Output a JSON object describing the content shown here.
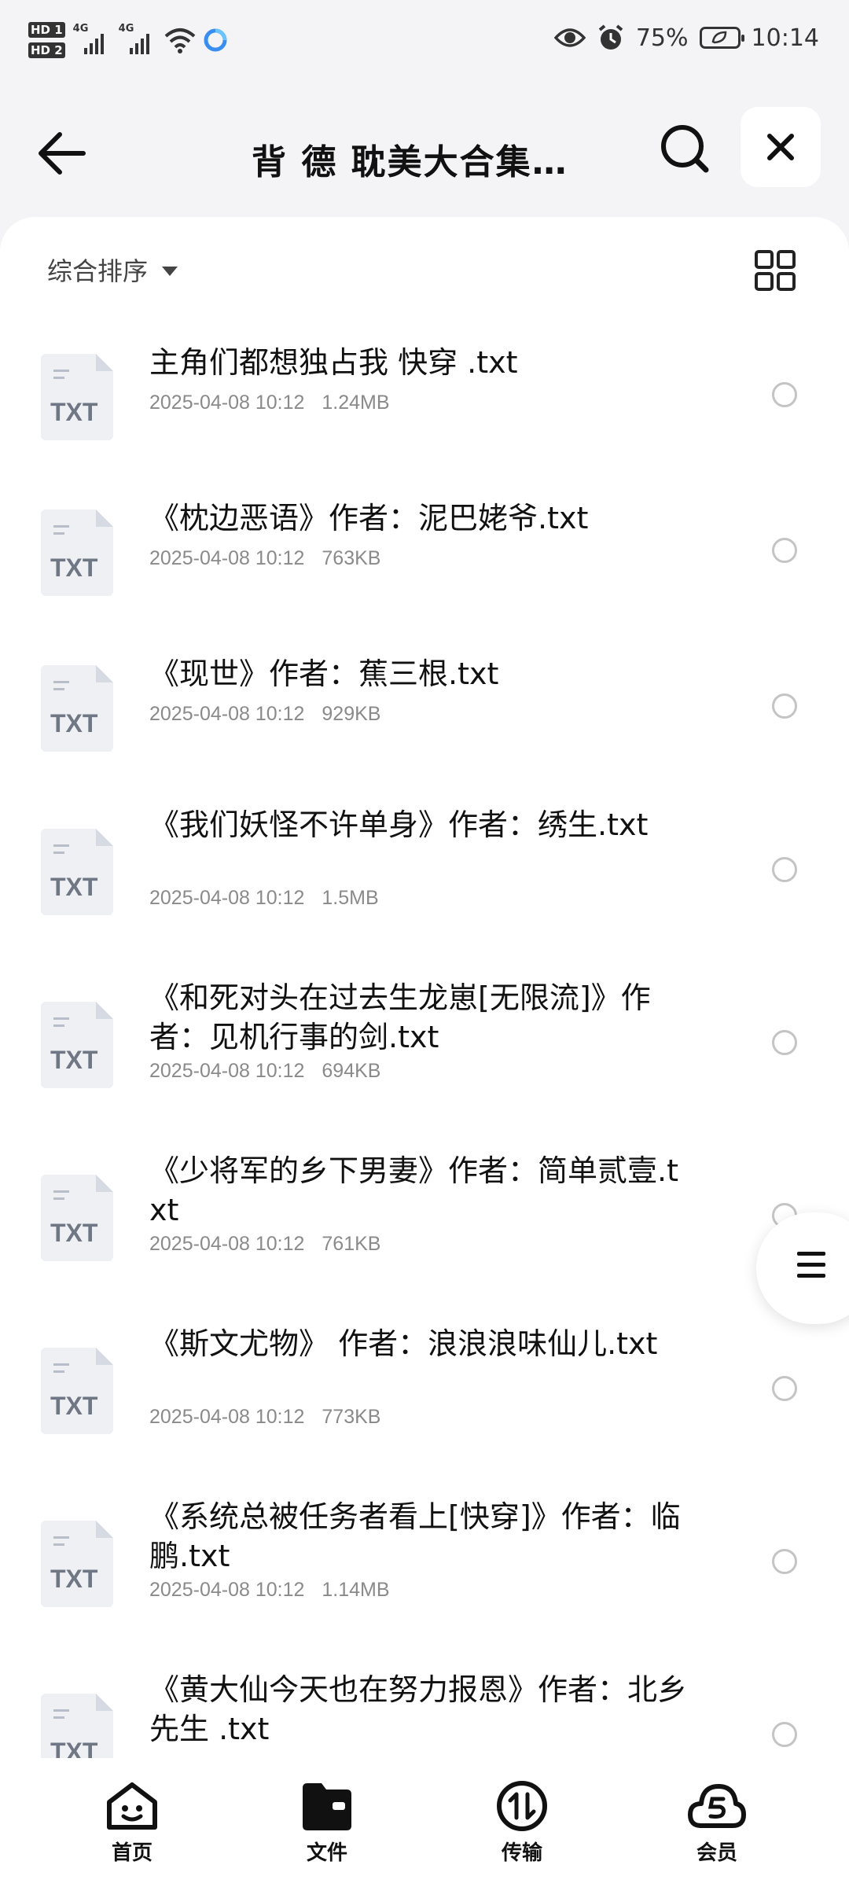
{
  "status_bar": {
    "hd1": "HD 1",
    "hd2": "HD 2",
    "net1": "4G",
    "net2": "4G",
    "battery_percent": "75%",
    "time": "10:14"
  },
  "header": {
    "title": "背 德 耽美大合集…"
  },
  "toolbar": {
    "sort_label": "综合排序"
  },
  "files": [
    {
      "name": "主角们都想独占我 快穿 .txt",
      "date": "2025-04-08 10:12",
      "size": "1.24MB"
    },
    {
      "name": "《枕边恶语》作者：泥巴姥爷.txt",
      "date": "2025-04-08 10:12",
      "size": "763KB"
    },
    {
      "name": "《现世》作者：蕉三根.txt",
      "date": "2025-04-08 10:12",
      "size": "929KB"
    },
    {
      "name": "《我们妖怪不许单身》作者：绣生.txt",
      "date": "2025-04-08 10:12",
      "size": "1.5MB"
    },
    {
      "name": "《和死对头在过去生龙崽[无限流]》作者：见机行事的剑.txt",
      "date": "2025-04-08 10:12",
      "size": "694KB"
    },
    {
      "name": "《少将军的乡下男妻》作者：简单贰壹.txt",
      "date": "2025-04-08 10:12",
      "size": "761KB"
    },
    {
      "name": "《斯文尤物》 作者：浪浪浪味仙儿.txt",
      "date": "2025-04-08 10:12",
      "size": "773KB"
    },
    {
      "name": "《系统总被任务者看上[快穿]》作者：临鹏.txt",
      "date": "2025-04-08 10:12",
      "size": "1.14MB"
    },
    {
      "name": "《黄大仙今天也在努力报恩》作者：北乡先生 .txt",
      "date": "",
      "size": ""
    }
  ],
  "file_icon_label": "TXT",
  "bottom_nav": [
    {
      "label": "首页",
      "icon": "home-face-icon"
    },
    {
      "label": "文件",
      "icon": "folder-icon"
    },
    {
      "label": "传输",
      "icon": "transfer-icon"
    },
    {
      "label": "会员",
      "icon": "vip-cloud-icon"
    }
  ]
}
